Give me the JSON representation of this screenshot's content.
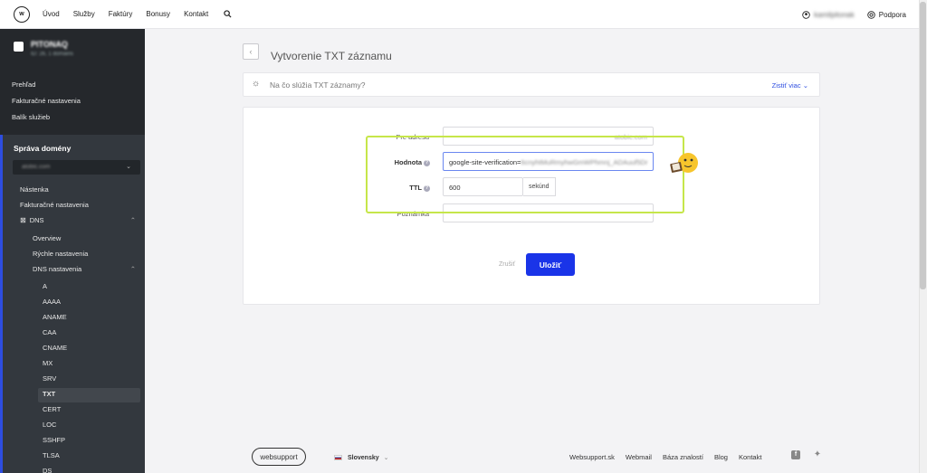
{
  "topbar": {
    "logo_text": "w",
    "nav": [
      "Úvod",
      "Služby",
      "Faktúry",
      "Bonusy",
      "Kontakt"
    ],
    "user_name": "kamilpitonak",
    "help_label": "Podpora"
  },
  "sidebar": {
    "account_name": "PITONAQ",
    "account_sub": "ID: 26, 1 domains",
    "links": [
      "Prehľad",
      "Fakturačné nastavenia",
      "Balík služieb"
    ],
    "section_title": "Správa domény",
    "domain_value": "atobic.com",
    "items": {
      "nastenka": "Nástenka",
      "fakturacne": "Fakturačné nastavenia",
      "dns": "DNS",
      "overview": "Overview",
      "rychle": "Rýchle nastavenia",
      "dns_nastavenia": "DNS nastavenia",
      "records": [
        "A",
        "AAAA",
        "ANAME",
        "CAA",
        "CNAME",
        "MX",
        "SRV",
        "TXT",
        "CERT",
        "LOC",
        "SSHFP",
        "TLSA",
        "DS"
      ],
      "active_record": "TXT"
    }
  },
  "main": {
    "title": "Vytvorenie TXT záznamu",
    "info_question": "Na čo slúžia TXT záznamy?",
    "info_more": "Zistiť viac",
    "form": {
      "pre_adresu_label": "Pre adresu",
      "pre_adresu_suffix": "atobic.com",
      "hodnota_label": "Hodnota",
      "hodnota_value_visible": "google-site-verification=",
      "hodnota_value_blurred": "6cnyhtMuRmyhwGmWPhmnj_ADAuuf5Dr",
      "ttl_label": "TTL",
      "ttl_value": "600",
      "ttl_unit": "sekúnd",
      "poznamka_label": "Poznámka",
      "cancel": "Zrušiť",
      "save": "Uložiť"
    }
  },
  "footer": {
    "logo": "websupport",
    "language": "Slovensky",
    "links": [
      "Websupport.sk",
      "Webmail",
      "Báza znalostí",
      "Blog",
      "Kontakt"
    ]
  },
  "colors": {
    "accent": "#1a34e8",
    "sidebar_bg": "#33383e",
    "highlight": "#c6e64a"
  }
}
